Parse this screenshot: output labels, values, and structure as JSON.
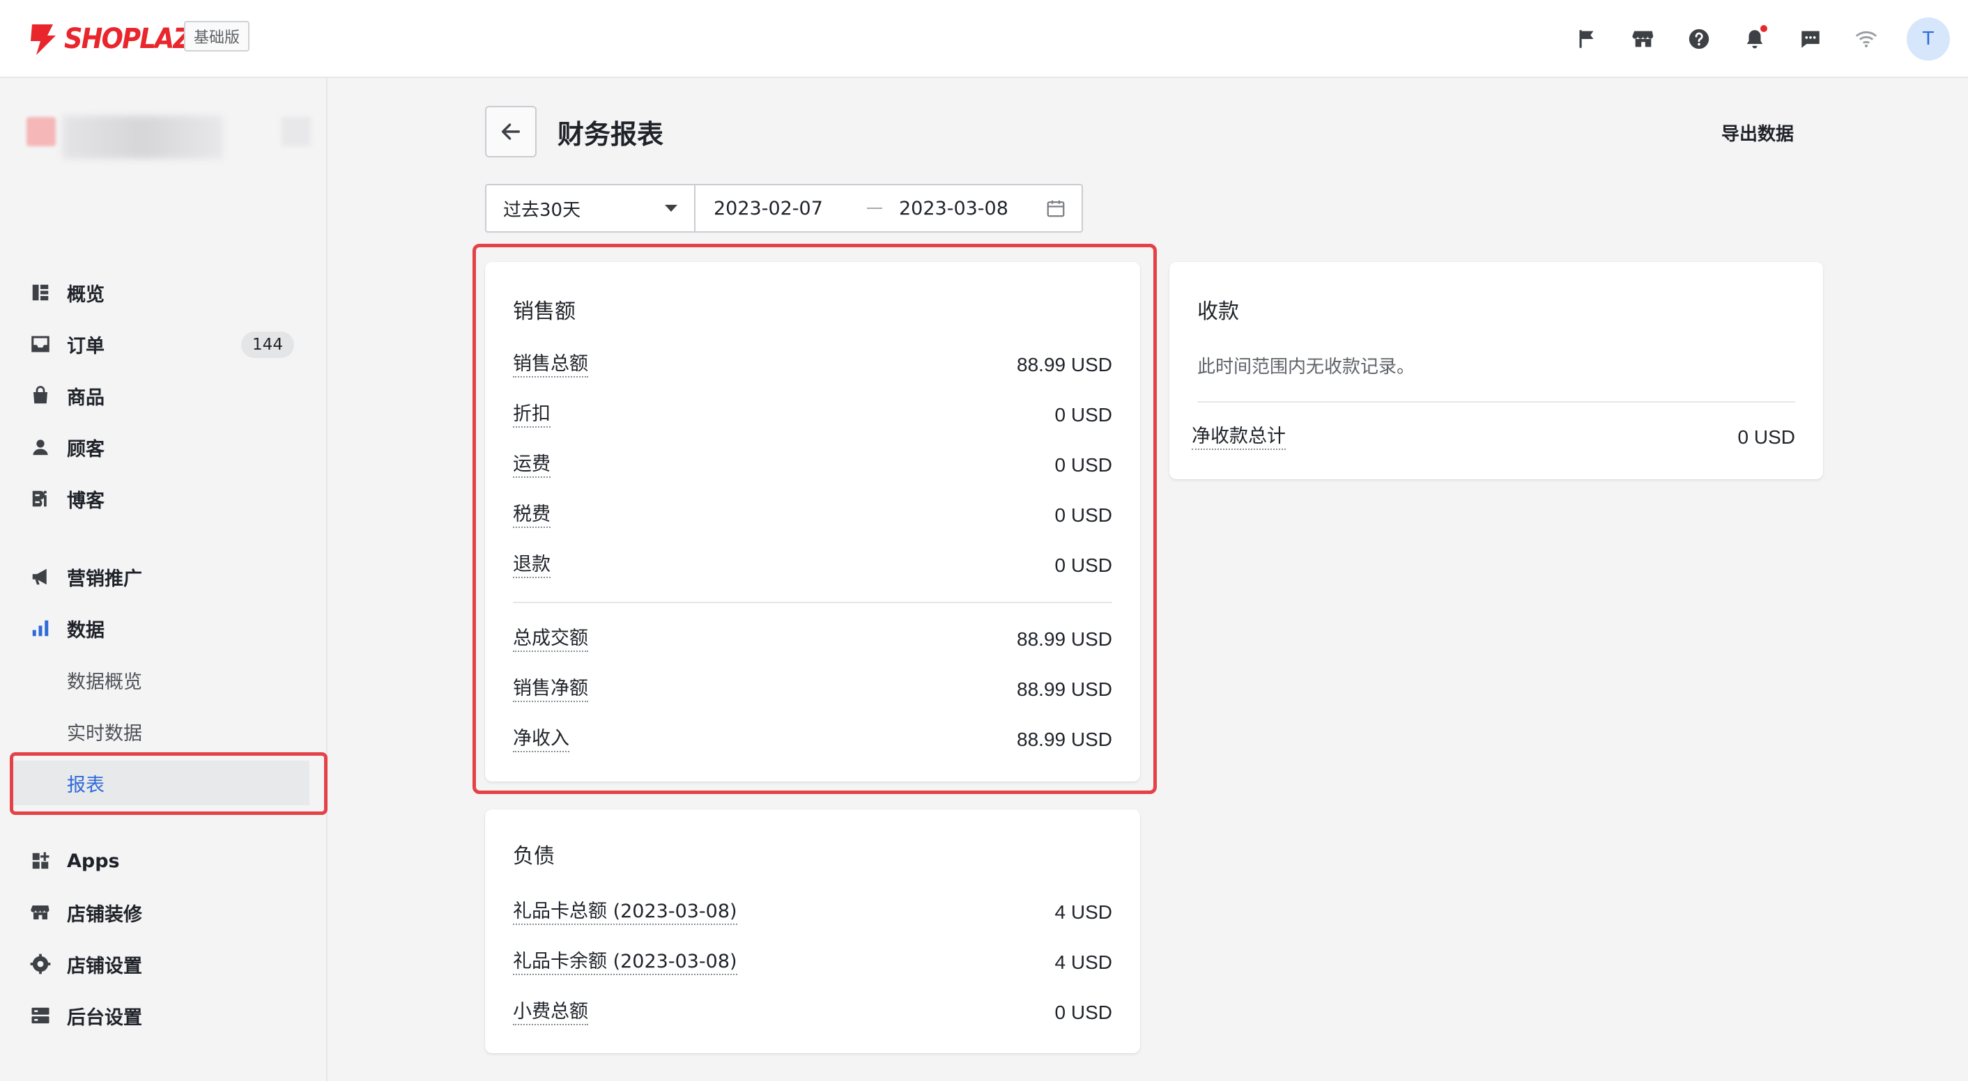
{
  "header": {
    "logo_text": "SHOPLAZZA",
    "edition": "基础版",
    "avatar_initial": "T",
    "icons": [
      "flag-icon",
      "storefront-icon",
      "help-icon",
      "bell-icon",
      "message-icon",
      "wifi-icon"
    ]
  },
  "sidebar": {
    "items": [
      {
        "label": "概览",
        "icon": "overview-icon"
      },
      {
        "label": "订单",
        "icon": "inbox-icon",
        "badge": "144"
      },
      {
        "label": "商品",
        "icon": "bag-icon"
      },
      {
        "label": "顾客",
        "icon": "person-icon"
      },
      {
        "label": "博客",
        "icon": "blog-icon"
      },
      {
        "label": "营销推广",
        "icon": "megaphone-icon"
      },
      {
        "label": "数据",
        "icon": "bar-chart-icon"
      },
      {
        "label": "数据概览"
      },
      {
        "label": "实时数据"
      },
      {
        "label": "报表",
        "active": true
      },
      {
        "label": "Apps",
        "icon": "apps-icon"
      },
      {
        "label": "店铺装修",
        "icon": "storefront-icon"
      },
      {
        "label": "店铺设置",
        "icon": "gear-icon"
      },
      {
        "label": "后台设置",
        "icon": "server-icon"
      }
    ]
  },
  "page": {
    "title": "财务报表",
    "export_label": "导出数据"
  },
  "filter": {
    "preset": "过去30天",
    "start_date": "2023-02-07",
    "end_date": "2023-03-08"
  },
  "sales": {
    "title": "销售额",
    "rows": [
      {
        "label": "销售总额",
        "value": "88.99 USD"
      },
      {
        "label": "折扣",
        "value": "0 USD"
      },
      {
        "label": "运费",
        "value": "0 USD"
      },
      {
        "label": "税费",
        "value": "0 USD"
      },
      {
        "label": "退款",
        "value": "0 USD"
      }
    ],
    "totals": [
      {
        "label": "总成交额",
        "value": "88.99 USD"
      },
      {
        "label": "销售净额",
        "value": "88.99 USD"
      },
      {
        "label": "净收入",
        "value": "88.99 USD"
      }
    ]
  },
  "liabilities": {
    "title": "负债",
    "rows": [
      {
        "label": "礼品卡总额 (2023-03-08)",
        "value": "4 USD"
      },
      {
        "label": "礼品卡余额 (2023-03-08)",
        "value": "4 USD"
      },
      {
        "label": "小费总额",
        "value": "0 USD"
      }
    ]
  },
  "payments": {
    "title": "收款",
    "empty_text": "此时间范围内无收款记录。",
    "total_label": "净收款总计",
    "total_value": "0 USD"
  },
  "colors": {
    "brand": "#e8262b",
    "accent": "#2f6ad9",
    "highlight": "#e54248"
  }
}
